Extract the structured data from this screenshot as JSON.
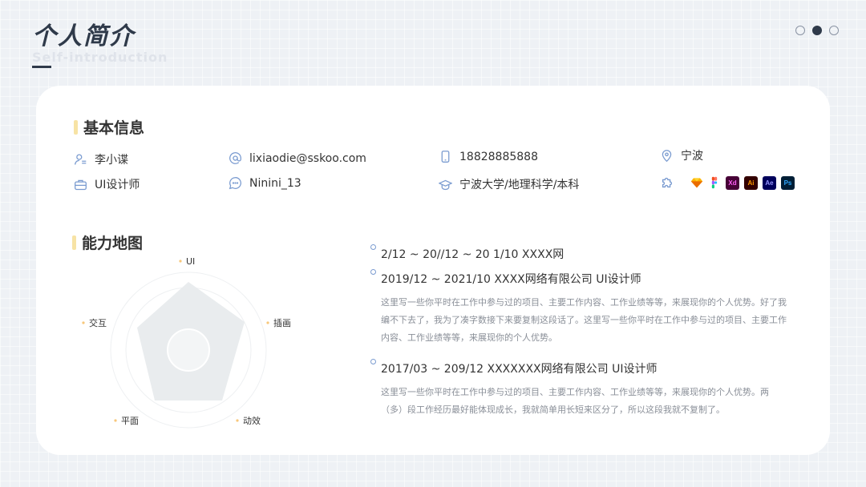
{
  "header": {
    "title": "个人简介",
    "subtitle": "Self-introduction"
  },
  "basic": {
    "title": "基本信息",
    "name": "李小谍",
    "email": "lixiaodie@sskoo.com",
    "phone": "18828885888",
    "city": "宁波",
    "role": "UI设计师",
    "wechat": "Ninini_13",
    "education": "宁波大学/地理科学/本科"
  },
  "tools": [
    {
      "name": "sketch-icon",
      "label": ""
    },
    {
      "name": "figma-icon",
      "label": ""
    },
    {
      "name": "xd-icon",
      "label": "Xd"
    },
    {
      "name": "illustrator-icon",
      "label": "Ai"
    },
    {
      "name": "after-effects-icon",
      "label": "Ae"
    },
    {
      "name": "photoshop-icon",
      "label": "Ps"
    }
  ],
  "ability": {
    "title": "能力地图",
    "axes": [
      "UI",
      "插画",
      "动效",
      "平面",
      "交互"
    ]
  },
  "experience": [
    {
      "head": "2/12 ~ 20//12 ~ 20 1/10   XXXX网",
      "desc": ""
    },
    {
      "head": "2019/12 ~ 2021/10   XXXX网络有限公司   UI设计师",
      "desc": "这里写一些你平时在工作中参与过的项目、主要工作内容、工作业绩等等，来展现你的个人优势。好了我编不下去了，我为了凑字数接下来要复制这段话了。这里写一些你平时在工作中参与过的项目、主要工作内容、工作业绩等等，来展现你的个人优势。"
    },
    {
      "head": "2017/03 ~ 209/12   XXXXXXX网络有限公司   UI设计师",
      "desc": "这里写一些你平时在工作中参与过的项目、主要工作内容、工作业绩等等，来展现你的个人优势。两（多）段工作经历最好能体现成长，我就简单用长短来区分了，所以这段我就不复制了。"
    }
  ],
  "colors": {
    "accent_bar": "#f7e3a5",
    "title": "#2f3a4a",
    "bullet": "#7a9bd0",
    "radar_fill": "#e9ecee"
  },
  "pagination": {
    "total": 3,
    "active": 2
  }
}
